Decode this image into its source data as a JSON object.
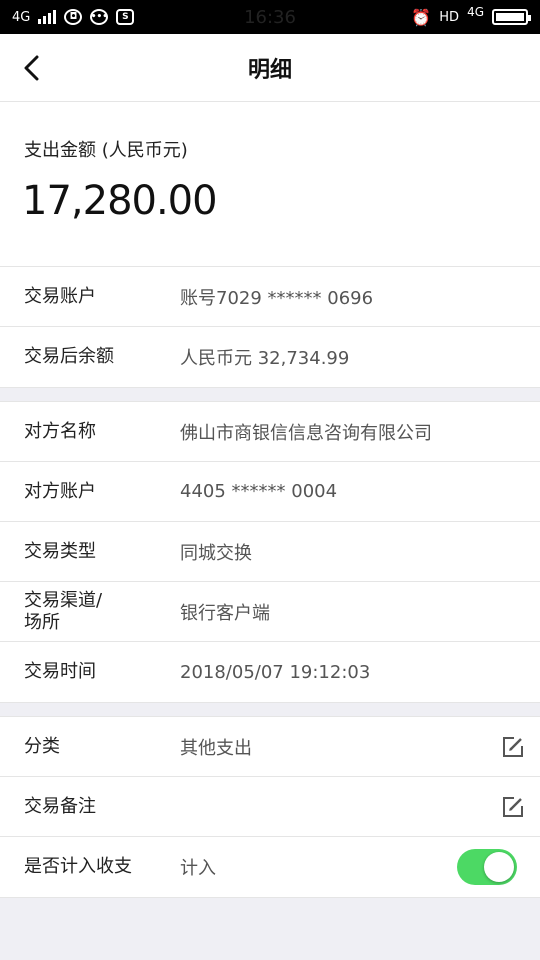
{
  "status_bar": {
    "network_left": "4G",
    "time": "16:36",
    "hd": "HD",
    "network_right": "4G"
  },
  "nav": {
    "title": "明细"
  },
  "amount": {
    "label": "支出金额 (人民币元)",
    "value": "17,280.00"
  },
  "account_section": [
    {
      "label": "交易账户",
      "value": "账号7029 ****** 0696"
    },
    {
      "label": "交易后余额",
      "value": "人民币元 32,734.99"
    }
  ],
  "detail_section": [
    {
      "label": "对方名称",
      "value": "佛山市商银信信息咨询有限公司"
    },
    {
      "label": "对方账户",
      "value": "4405 ****** 0004"
    },
    {
      "label": "交易类型",
      "value": "同城交换"
    },
    {
      "label": "交易渠道/\n场所",
      "value": "银行客户端"
    },
    {
      "label": "交易时间",
      "value": "2018/05/07 19:12:03"
    }
  ],
  "category_section": {
    "category": {
      "label": "分类",
      "value": "其他支出",
      "icon": "edit-icon"
    },
    "note": {
      "label": "交易备注",
      "value": "",
      "icon": "edit-icon"
    },
    "include": {
      "label": "是否计入收支",
      "value": "计入",
      "toggle_on": true,
      "toggle_color": "#4cd964"
    }
  }
}
